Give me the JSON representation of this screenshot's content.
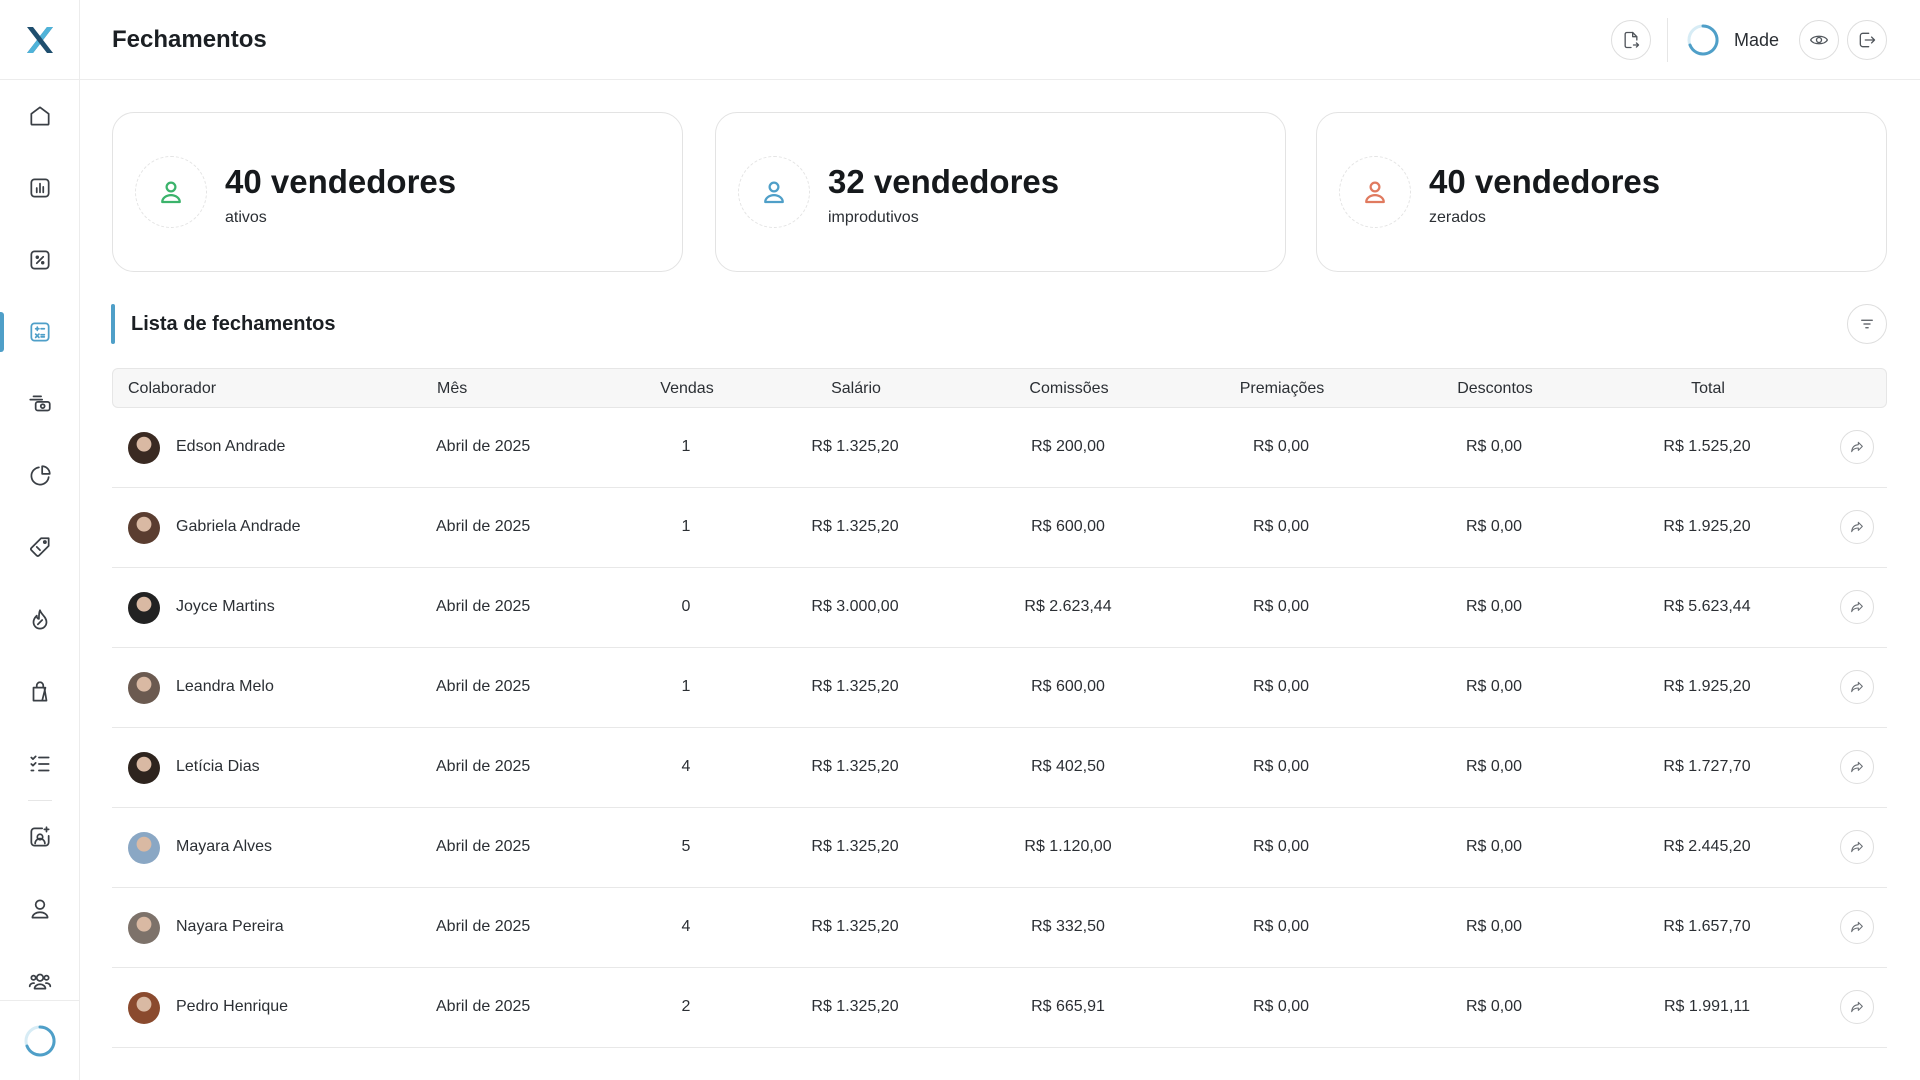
{
  "header": {
    "title": "Fechamentos",
    "store_name": "Made",
    "icons": [
      "document-export-icon",
      "store-loader-icon",
      "eye-icon",
      "logout-icon"
    ]
  },
  "sidebar": {
    "logo": "app-logo",
    "items": [
      {
        "icon": "home-icon"
      },
      {
        "icon": "chart-bar-icon"
      },
      {
        "icon": "percent-icon"
      },
      {
        "icon": "calculator-icon",
        "active": true
      },
      {
        "icon": "cash-icon"
      },
      {
        "icon": "pie-chart-icon"
      },
      {
        "icon": "tag-icon"
      },
      {
        "icon": "flame-icon"
      },
      {
        "icon": "shopping-bag-icon"
      },
      {
        "icon": "checklist-icon"
      },
      {
        "icon": "image-sparkle-icon"
      },
      {
        "icon": "user-icon"
      },
      {
        "icon": "users-icon"
      }
    ]
  },
  "cards": [
    {
      "value": "40 vendedores",
      "label": "ativos",
      "color": "#3bb36b"
    },
    {
      "value": "32 vendedores",
      "label": "improdutivos",
      "color": "#4f9fc8"
    },
    {
      "value": "40 vendedores",
      "label": "zerados",
      "color": "#e07a5f"
    }
  ],
  "section": {
    "title": "Lista de fechamentos"
  },
  "table": {
    "columns": [
      "Colaborador",
      "Mês",
      "Vendas",
      "Salário",
      "Comissões",
      "Premiações",
      "Descontos",
      "Total"
    ],
    "rows": [
      {
        "name": "Edson Andrade",
        "month": "Abril de 2025",
        "sales": "1",
        "salary": "R$ 1.325,20",
        "commissions": "R$ 200,00",
        "awards": "R$ 0,00",
        "discounts": "R$ 0,00",
        "total": "R$ 1.525,20",
        "avatar_color": "#3a2a22"
      },
      {
        "name": "Gabriela Andrade",
        "month": "Abril de 2025",
        "sales": "1",
        "salary": "R$ 1.325,20",
        "commissions": "R$ 600,00",
        "awards": "R$ 0,00",
        "discounts": "R$ 0,00",
        "total": "R$ 1.925,20",
        "avatar_color": "#5a3d30"
      },
      {
        "name": "Joyce Martins",
        "month": "Abril de 2025",
        "sales": "0",
        "salary": "R$ 3.000,00",
        "commissions": "R$ 2.623,44",
        "awards": "R$ 0,00",
        "discounts": "R$ 0,00",
        "total": "R$ 5.623,44",
        "avatar_color": "#222222"
      },
      {
        "name": "Leandra Melo",
        "month": "Abril de 2025",
        "sales": "1",
        "salary": "R$ 1.325,20",
        "commissions": "R$ 600,00",
        "awards": "R$ 0,00",
        "discounts": "R$ 0,00",
        "total": "R$ 1.925,20",
        "avatar_color": "#6b5a50"
      },
      {
        "name": "Letícia Dias",
        "month": "Abril de 2025",
        "sales": "4",
        "salary": "R$ 1.325,20",
        "commissions": "R$ 402,50",
        "awards": "R$ 0,00",
        "discounts": "R$ 0,00",
        "total": "R$ 1.727,70",
        "avatar_color": "#2e241e"
      },
      {
        "name": "Mayara Alves",
        "month": "Abril de 2025",
        "sales": "5",
        "salary": "R$ 1.325,20",
        "commissions": "R$ 1.120,00",
        "awards": "R$ 0,00",
        "discounts": "R$ 0,00",
        "total": "R$ 2.445,20",
        "avatar_color": "#8aa7c4"
      },
      {
        "name": "Nayara Pereira",
        "month": "Abril de 2025",
        "sales": "4",
        "salary": "R$ 1.325,20",
        "commissions": "R$ 332,50",
        "awards": "R$ 0,00",
        "discounts": "R$ 0,00",
        "total": "R$ 1.657,70",
        "avatar_color": "#7d726a"
      },
      {
        "name": "Pedro Henrique",
        "month": "Abril de 2025",
        "sales": "2",
        "salary": "R$ 1.325,20",
        "commissions": "R$ 665,91",
        "awards": "R$ 0,00",
        "discounts": "R$ 0,00",
        "total": "R$ 1.991,11",
        "avatar_color": "#8a4a2e"
      }
    ]
  }
}
